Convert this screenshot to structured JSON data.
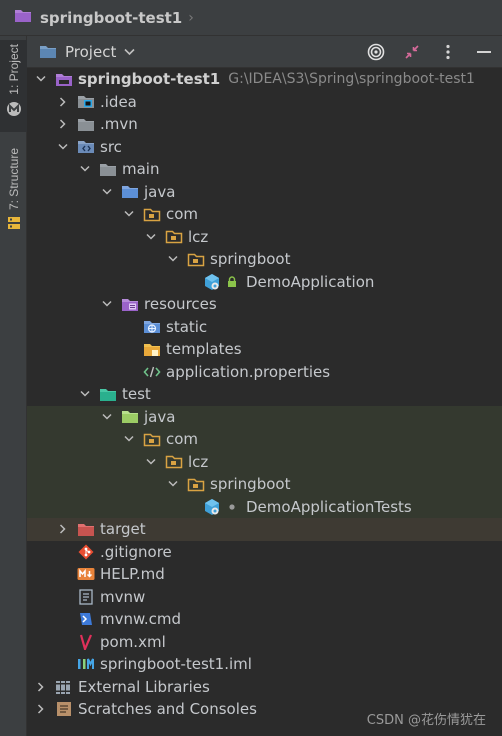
{
  "breadcrumb": {
    "project_name": "springboot-test1"
  },
  "side_tabs": {
    "project": "1: Project",
    "structure": "7: Structure"
  },
  "panel": {
    "title": "Project"
  },
  "tree": {
    "root": {
      "label": "springboot-test1",
      "path": "G:\\IDEA\\S3\\Spring\\springboot-test1"
    },
    "idea": ".idea",
    "mvn": ".mvn",
    "src": "src",
    "main": "main",
    "main_java": "java",
    "main_com": "com",
    "main_lcz": "lcz",
    "main_springboot": "springboot",
    "demo_application": "DemoApplication",
    "resources": "resources",
    "static": "static",
    "templates": "templates",
    "application_properties": "application.properties",
    "test": "test",
    "test_java": "java",
    "test_com": "com",
    "test_lcz": "lcz",
    "test_springboot": "springboot",
    "demo_application_tests": "DemoApplicationTests",
    "target": "target",
    "gitignore": ".gitignore",
    "help_md": "HELP.md",
    "mvnw": "mvnw",
    "mvnw_cmd": "mvnw.cmd",
    "pom_xml": "pom.xml",
    "iml": "springboot-test1.iml",
    "external_libraries": "External Libraries",
    "scratches": "Scratches and Consoles"
  },
  "watermark": "CSDN @花伤情犹在",
  "colors": {
    "background": "#2b2b2b",
    "source_folder": "#5c8fd6",
    "test_folder": "#62b543",
    "resources_folder": "#9a63c9",
    "excluded_folder": "#c75450",
    "package_folder": "#d9a343"
  }
}
